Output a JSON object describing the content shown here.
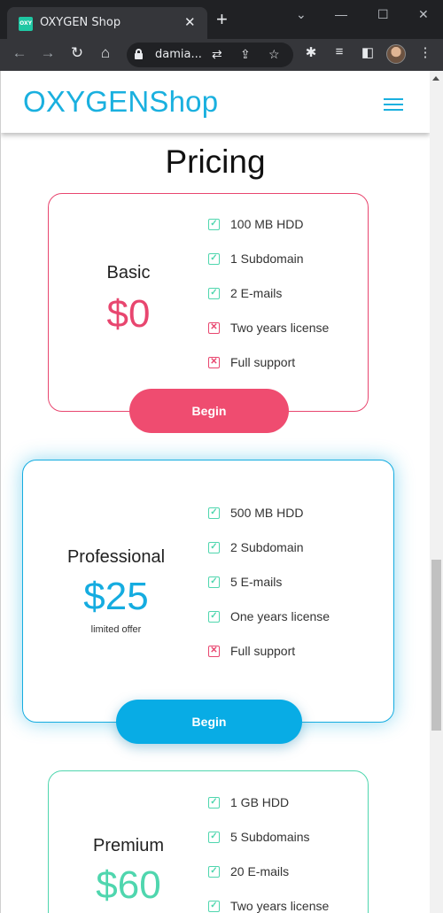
{
  "browser": {
    "tab_title": "OXYGEN Shop",
    "favicon_text": "OXY",
    "url": "damia...",
    "window_controls": [
      "minimize",
      "maximize",
      "close"
    ]
  },
  "site": {
    "logo": "OXYGENShop",
    "menu_icon": "hamburger-menu-icon"
  },
  "pricing": {
    "title": "Pricing",
    "plans": [
      {
        "name": "Basic",
        "price": "$0",
        "note": "",
        "accent": "#ef4c70",
        "features": [
          {
            "label": "100 MB HDD",
            "included": true
          },
          {
            "label": "1 Subdomain",
            "included": true
          },
          {
            "label": "2 E-mails",
            "included": true
          },
          {
            "label": "Two years license",
            "included": false
          },
          {
            "label": "Full support",
            "included": false
          }
        ],
        "button": "Begin"
      },
      {
        "name": "Professional",
        "price": "$25",
        "note": "limited offer",
        "accent": "#08ace5",
        "features": [
          {
            "label": "500 MB HDD",
            "included": true
          },
          {
            "label": "2 Subdomain",
            "included": true
          },
          {
            "label": "5 E-mails",
            "included": true
          },
          {
            "label": "One years license",
            "included": true
          },
          {
            "label": "Full support",
            "included": false
          }
        ],
        "button": "Begin"
      },
      {
        "name": "Premium",
        "price": "$60",
        "note": "",
        "accent": "#4fd6ae",
        "features": [
          {
            "label": "1 GB HDD",
            "included": true
          },
          {
            "label": "5 Subdomains",
            "included": true
          },
          {
            "label": "20 E-mails",
            "included": true
          },
          {
            "label": "Two years license",
            "included": true
          }
        ],
        "button": ""
      }
    ]
  },
  "colors": {
    "brand": "#1ab0df",
    "included": "#4fd6ae",
    "excluded": "#e8466f"
  }
}
